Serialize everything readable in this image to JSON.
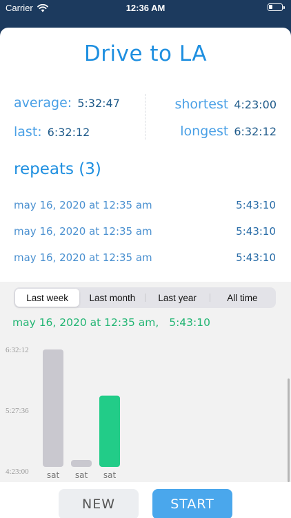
{
  "status": {
    "carrier": "Carrier",
    "time": "12:36 AM"
  },
  "title": "Drive to LA",
  "stats": {
    "average_label": "average:",
    "average_value": "5:32:47",
    "last_label": "last:",
    "last_value": "6:32:12",
    "shortest_label": "shortest",
    "shortest_value": "4:23:00",
    "longest_label": "longest",
    "longest_value": "6:32:12"
  },
  "repeats": {
    "title": "repeats (3)",
    "items": [
      {
        "date": "may 16, 2020 at 12:35 am",
        "duration": "5:43:10"
      },
      {
        "date": "may 16, 2020 at 12:35 am",
        "duration": "5:43:10"
      },
      {
        "date": "may 16, 2020 at 12:35 am",
        "duration": "5:43:10"
      }
    ]
  },
  "range_tabs": [
    "Last week",
    "Last month",
    "Last year",
    "All time"
  ],
  "active_tab": "Last week",
  "selected": {
    "date": "may 16, 2020 at 12:35 am,",
    "duration": "5:43:10"
  },
  "chart_data": {
    "type": "bar",
    "categories": [
      "sat",
      "sat",
      "sat"
    ],
    "values_seconds": [
      23532,
      16200,
      20590
    ],
    "y_ticks": [
      "6:32:12",
      "5:27:36",
      "4:23:00"
    ],
    "y_tick_seconds": [
      23532,
      19656,
      15780
    ],
    "ylim_seconds": [
      15780,
      23532
    ],
    "highlight_index": 2,
    "colors": {
      "bar": "#c9c8cf",
      "highlight": "#22cc88"
    }
  },
  "buttons": {
    "new_label": "NEW",
    "start_label": "START"
  },
  "colors": {
    "accent": "#1e8fe0",
    "success": "#22b573"
  }
}
